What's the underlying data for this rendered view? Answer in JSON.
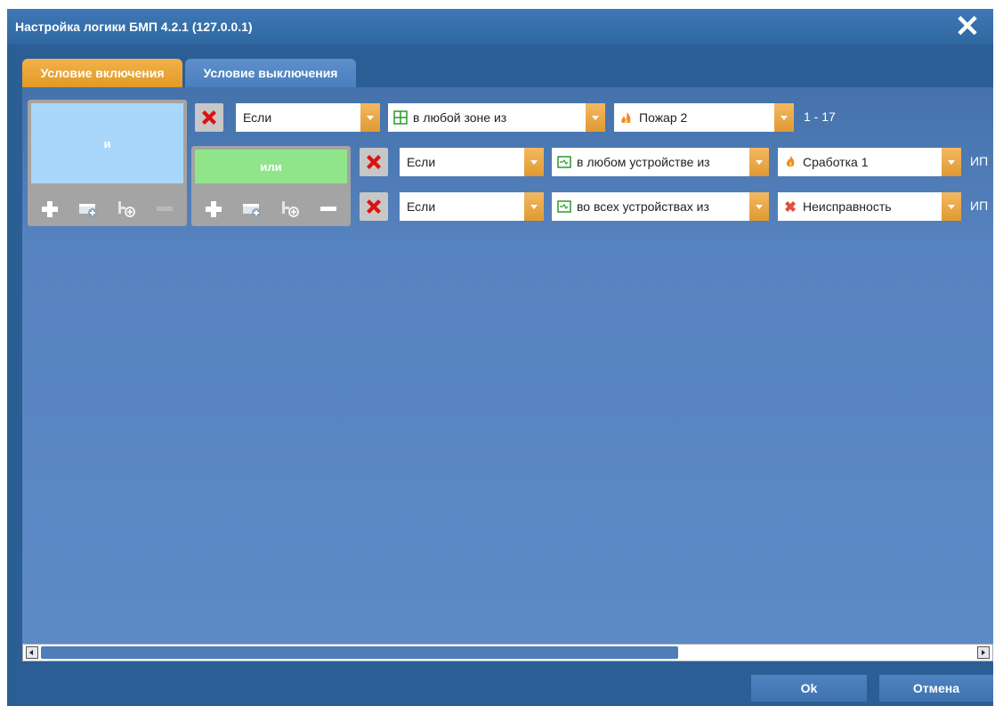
{
  "window": {
    "title": "Настройка логики БМП 4.2.1 (127.0.0.1)"
  },
  "tabs": [
    {
      "label": "Условие включения",
      "active": true
    },
    {
      "label": "Условие выключения",
      "active": false
    }
  ],
  "groups": {
    "outer": {
      "label": "и",
      "color": "#a9d7fb"
    },
    "inner": {
      "label": "или",
      "color": "#90e58a"
    }
  },
  "rows": [
    {
      "condition": "Если",
      "scope": {
        "text": "в любой зоне из",
        "icon": "zone-grid-icon"
      },
      "state": {
        "text": "Пожар 2",
        "icon": "fire-zone-icon"
      },
      "target": "1 - 17"
    },
    {
      "condition": "Если",
      "scope": {
        "text": "в любом устройстве из",
        "icon": "device-icon"
      },
      "state": {
        "text": "Сработка 1",
        "icon": "flame-icon"
      },
      "target": "ИП"
    },
    {
      "condition": "Если",
      "scope": {
        "text": "во всех устройствах из",
        "icon": "device-icon"
      },
      "state": {
        "text": "Неисправность",
        "icon": "fault-icon"
      },
      "target": "ИП"
    }
  ],
  "footer": {
    "ok_label": "Ok",
    "cancel_label": "Отмена"
  },
  "colors": {
    "accent": "#e9a43a",
    "panel": "#5784c0",
    "delete": "#e01010"
  }
}
